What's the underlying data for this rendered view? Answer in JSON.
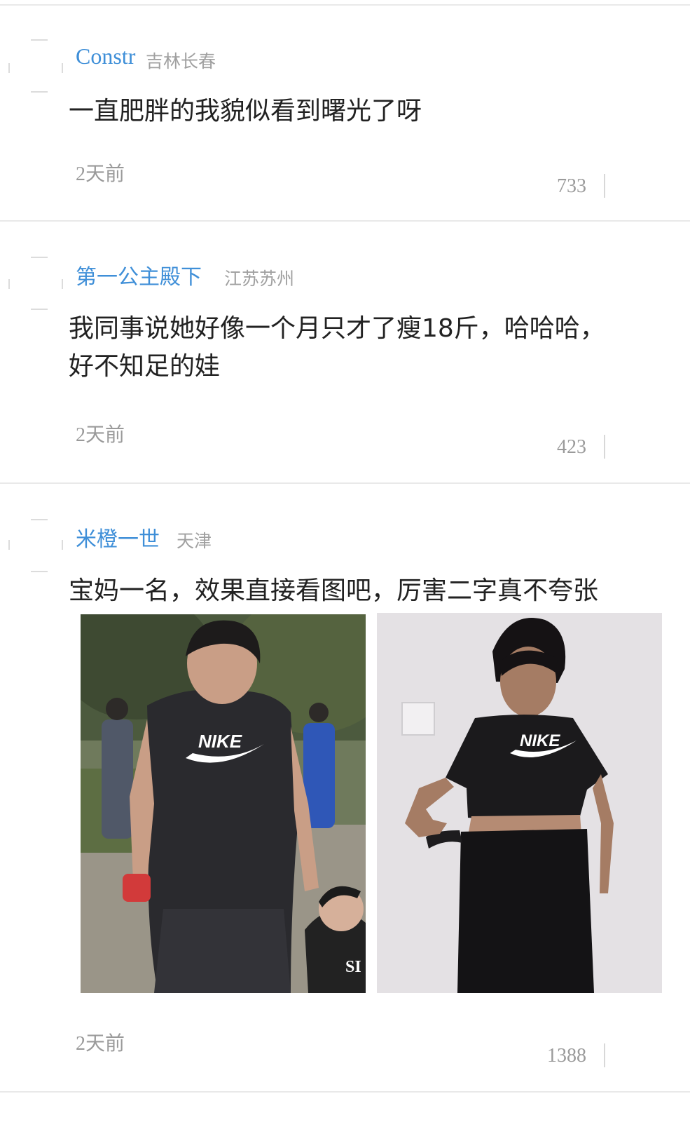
{
  "comments": [
    {
      "user": "Constr",
      "location": "吉林长春",
      "text": "一直肥胖的我貌似看到曙光了呀",
      "time": "2天前",
      "likes": "733"
    },
    {
      "user": "第一公主殿下",
      "location": "江苏苏州",
      "text": "我同事说她好像一个月只才了瘦18斤，哈哈哈，\n好不知足的娃",
      "time": "2天前",
      "likes": "423"
    },
    {
      "user": "米橙一世",
      "location": "天津",
      "text": "宝妈一名，效果直接看图吧，厉害二字真不夸张",
      "time": "2天前",
      "likes": "1388",
      "images": [
        {
          "icon": "before-photo",
          "logo_text": "NIKE",
          "child_shirt_text": "SI"
        },
        {
          "icon": "after-photo",
          "logo_text": "NIKE"
        }
      ]
    }
  ],
  "colors": {
    "username": "#3f8fd8",
    "location": "#a0a0a0",
    "text": "#222222",
    "meta": "#9a9a9a"
  }
}
